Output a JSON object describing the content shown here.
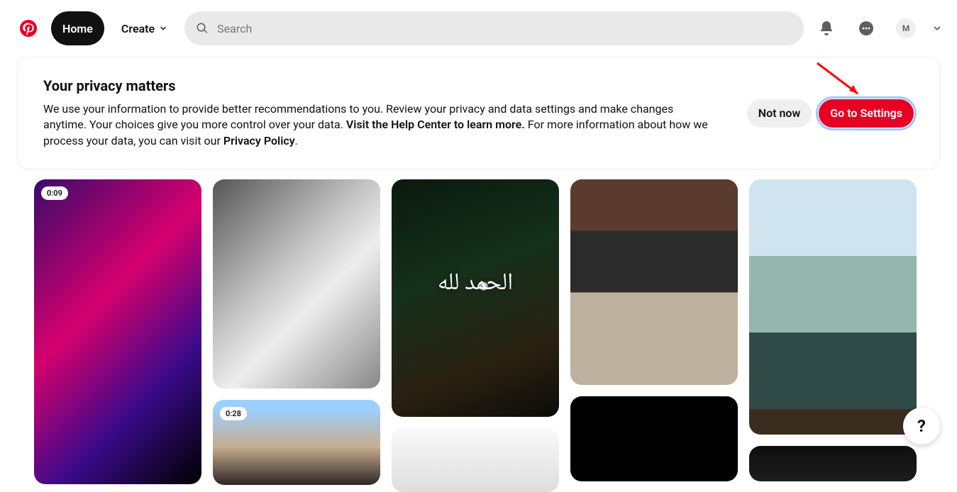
{
  "header": {
    "home_label": "Home",
    "create_label": "Create",
    "search_placeholder": "Search",
    "avatar_initial": "M"
  },
  "banner": {
    "title": "Your privacy matters",
    "body_1": "We use your information to provide better recommendations to you. Review your privacy and data settings and make changes anytime. Your choices give you more control over your data. ",
    "body_link1": "Visit the Help Center to learn more.",
    "body_2": " For more information about how we process your data, you can visit our ",
    "body_link2": "Privacy Policy",
    "body_3": ".",
    "not_now_label": "Not now",
    "settings_label": "Go to Settings"
  },
  "pins": {
    "badge1": "0:09",
    "badge2": "0:28",
    "calligraphy": "الحمد لله"
  },
  "fab": {
    "label": "?"
  }
}
